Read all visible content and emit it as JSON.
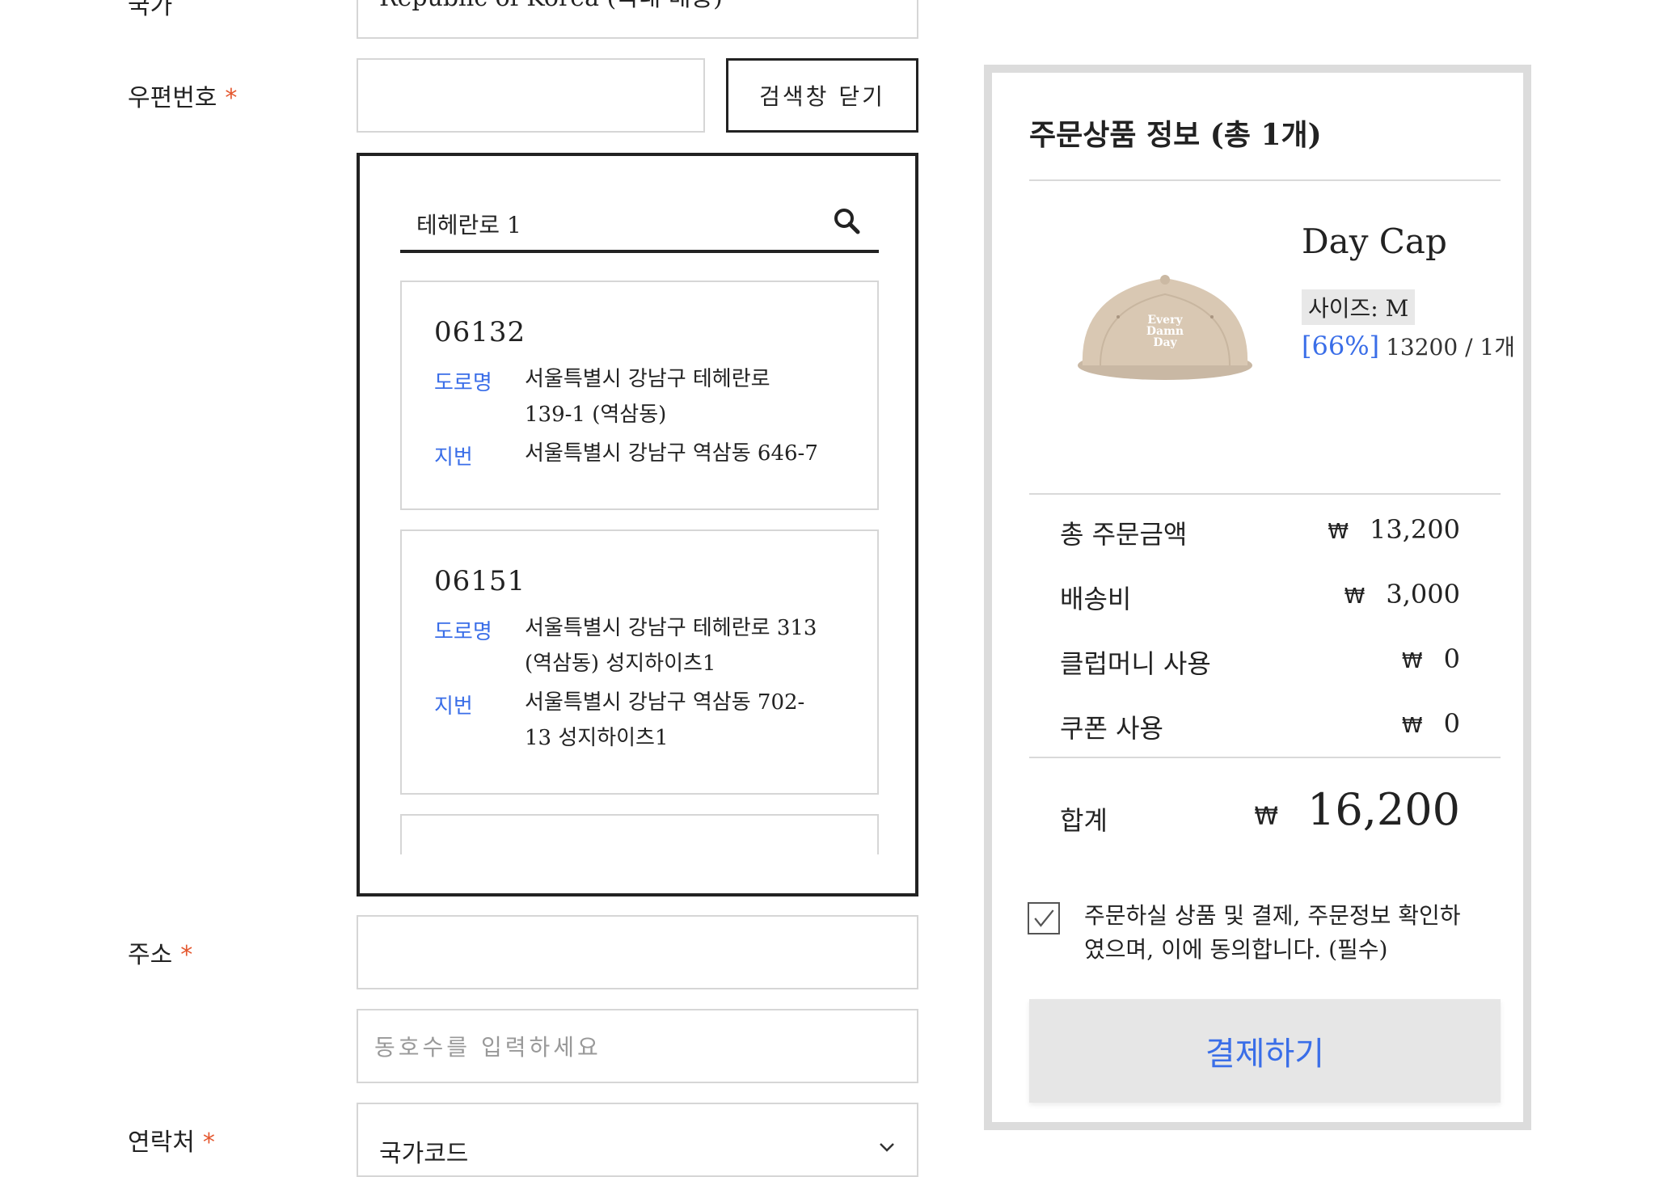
{
  "form": {
    "country_label": "국가",
    "country_value": "Republic of Korea (국내 배송)",
    "zipcode_label": "우편번호",
    "zipcode_value": "",
    "close_search_label": "검색창 닫기",
    "address_label": "주소",
    "address_value": "",
    "detail_placeholder": "동호수를 입력하세요",
    "contact_label": "연락처",
    "country_code_value": "국가코드",
    "required_mark": "*"
  },
  "address_search": {
    "query": "테헤란로 1",
    "results": [
      {
        "zip": "06132",
        "road_tag": "도로명",
        "road_line1": "서울특별시 강남구 테헤란로",
        "road_line2": "139-1 (역삼동)",
        "jibun_tag": "지번",
        "jibun_line1": "서울특별시 강남구 역삼동 646-7",
        "jibun_line2": ""
      },
      {
        "zip": "06151",
        "road_tag": "도로명",
        "road_line1": "서울특별시 강남구 테헤란로 313",
        "road_line2": "(역삼동) 성지하이츠1",
        "jibun_tag": "지번",
        "jibun_line1": "서울특별시 강남구 역삼동 702-",
        "jibun_line2": "13 성지하이츠1"
      }
    ]
  },
  "order": {
    "title": "주문상품 정보 (총 1개)",
    "product": {
      "name": "Day Cap",
      "size": "사이즈: M",
      "discount": "[66%]",
      "price_qty": "13200 / 1개",
      "image_icon": "cap-product-image"
    },
    "currency": "₩",
    "summary": [
      {
        "label": "총 주문금액",
        "value": "13,200"
      },
      {
        "label": "배송비",
        "value": "3,000"
      },
      {
        "label": "클럽머니 사용",
        "value": "0"
      },
      {
        "label": "쿠폰 사용",
        "value": "0"
      }
    ],
    "total_label": "합계",
    "total_value": "16,200",
    "agree_text": "주문하실 상품 및 결제, 주문정보 확인하였으며, 이에 동의합니다. (필수)",
    "agree_checked": true,
    "pay_label": "결제하기"
  },
  "colors": {
    "accent_blue": "#3a6ee8",
    "required_orange": "#e4572e",
    "panel_border": "#dcdcdc"
  }
}
